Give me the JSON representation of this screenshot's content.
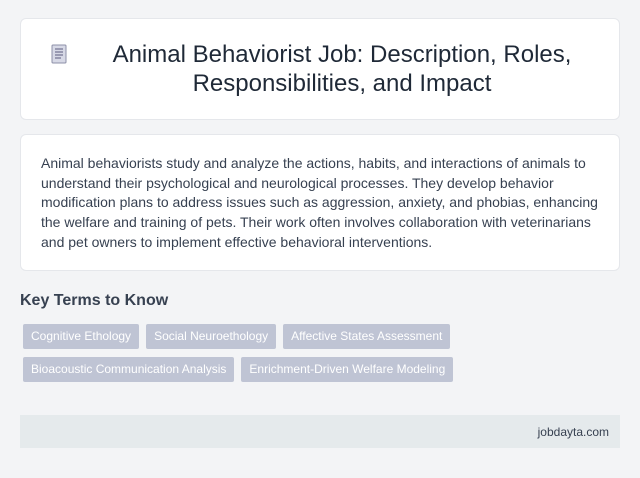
{
  "header": {
    "icon": "document-icon",
    "title": "Animal Behaviorist Job: Description, Roles, Responsibilities, and Impact"
  },
  "summary": {
    "text": "Animal behaviorists study and analyze the actions, habits, and interactions of animals to understand their psychological and neurological processes. They develop behavior modification plans to address issues such as aggression, anxiety, and phobias, enhancing the welfare and training of pets. Their work often involves collaboration with veterinarians and pet owners to implement effective behavioral interventions."
  },
  "key_terms": {
    "heading": "Key Terms to Know",
    "tags": [
      "Cognitive Ethology",
      "Social Neuroethology",
      "Affective States Assessment",
      "Bioacoustic Communication Analysis",
      "Enrichment-Driven Welfare Modeling"
    ]
  },
  "footer": {
    "site": "jobdayta.com"
  },
  "colors": {
    "background": "#f3f4f6",
    "tag_background": "#bfc4d4",
    "footer_background": "#e5eaec"
  }
}
